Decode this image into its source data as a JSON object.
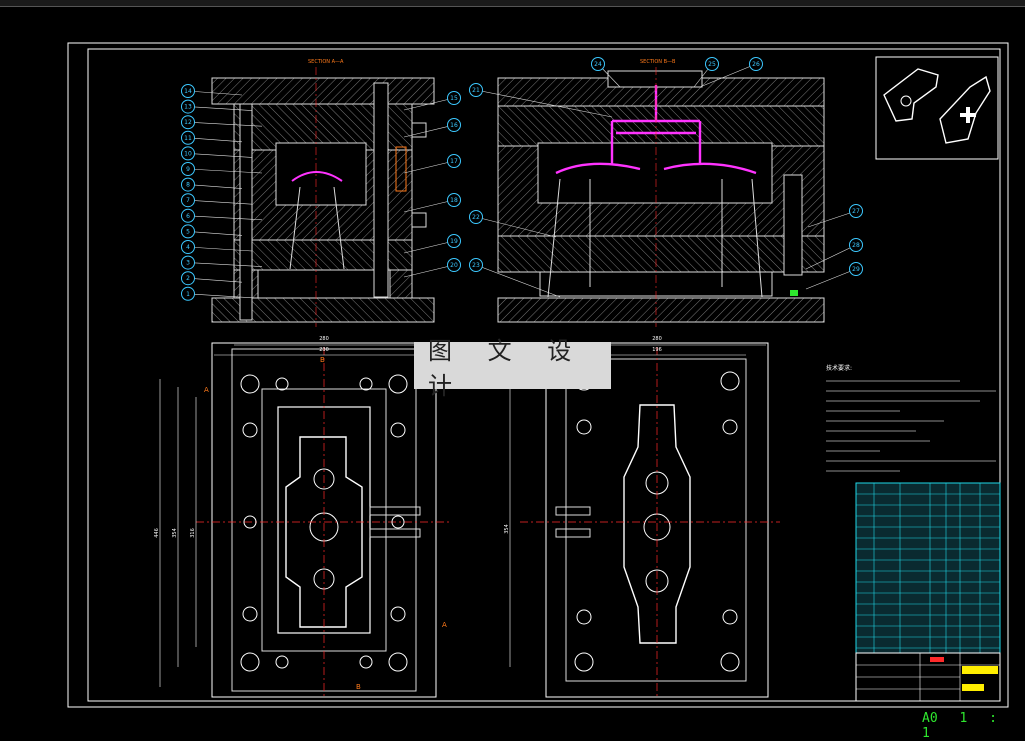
{
  "watermark": "图 文 设 计",
  "status": {
    "sheet": "A0",
    "scale": "1 : 1"
  },
  "sections": {
    "a": "SECTION A—A",
    "b": "SECTION B—B"
  },
  "section_markers": [
    "A",
    "A",
    "B",
    "B"
  ],
  "notes_title": "技术要求:",
  "callouts_left": [
    "14",
    "13",
    "12",
    "11",
    "10",
    "9",
    "8",
    "7",
    "6",
    "5",
    "4",
    "3",
    "2",
    "1"
  ],
  "callouts_mid": [
    "15",
    "16",
    "17",
    "18",
    "19",
    "20"
  ],
  "callouts_right": [
    "21",
    "22",
    "23",
    "24",
    "25",
    "26",
    "27",
    "28",
    "29"
  ],
  "dims_top": [
    "280",
    "230"
  ],
  "dims_right_top": [
    "280",
    "196"
  ],
  "dims_left": [
    "446",
    "354",
    "316"
  ],
  "dims_right_left": [
    "354"
  ],
  "colors": {
    "frame": "#ffffff",
    "part": "#cfcfcf",
    "callout": "#3cc8ff",
    "center": "#ff2a2a",
    "runner": "#ff33ff",
    "title_block": "#1fd8e8",
    "status": "#2ee82e"
  }
}
